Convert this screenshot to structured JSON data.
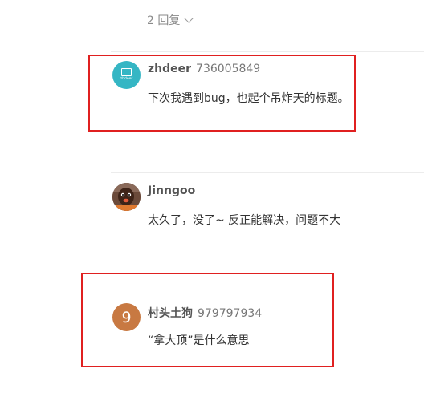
{
  "replies": {
    "label": "2 回复"
  },
  "comments": [
    {
      "username": "zhdeer",
      "user_id": "736005849",
      "text": "下次我遇到bug，也起个吊炸天的标题。",
      "avatar": {
        "type": "logo",
        "color": "#35b6c4",
        "logo_text": "zhdeer"
      }
    },
    {
      "username": "Jinngoo",
      "user_id": "",
      "text": "太久了，没了~ 反正能解决，问题不大",
      "avatar": {
        "type": "photo",
        "color": "#5b3a2a"
      }
    },
    {
      "username": "村头土狗",
      "user_id": "979797934",
      "text": "“拿大顶”是什么意思",
      "avatar": {
        "type": "letter",
        "letter": "9",
        "color": "#c87942"
      }
    }
  ],
  "colors": {
    "highlight": "#e02020",
    "divider": "#ececec"
  },
  "icons": {
    "replies_toggle": "chevron-down-icon"
  }
}
